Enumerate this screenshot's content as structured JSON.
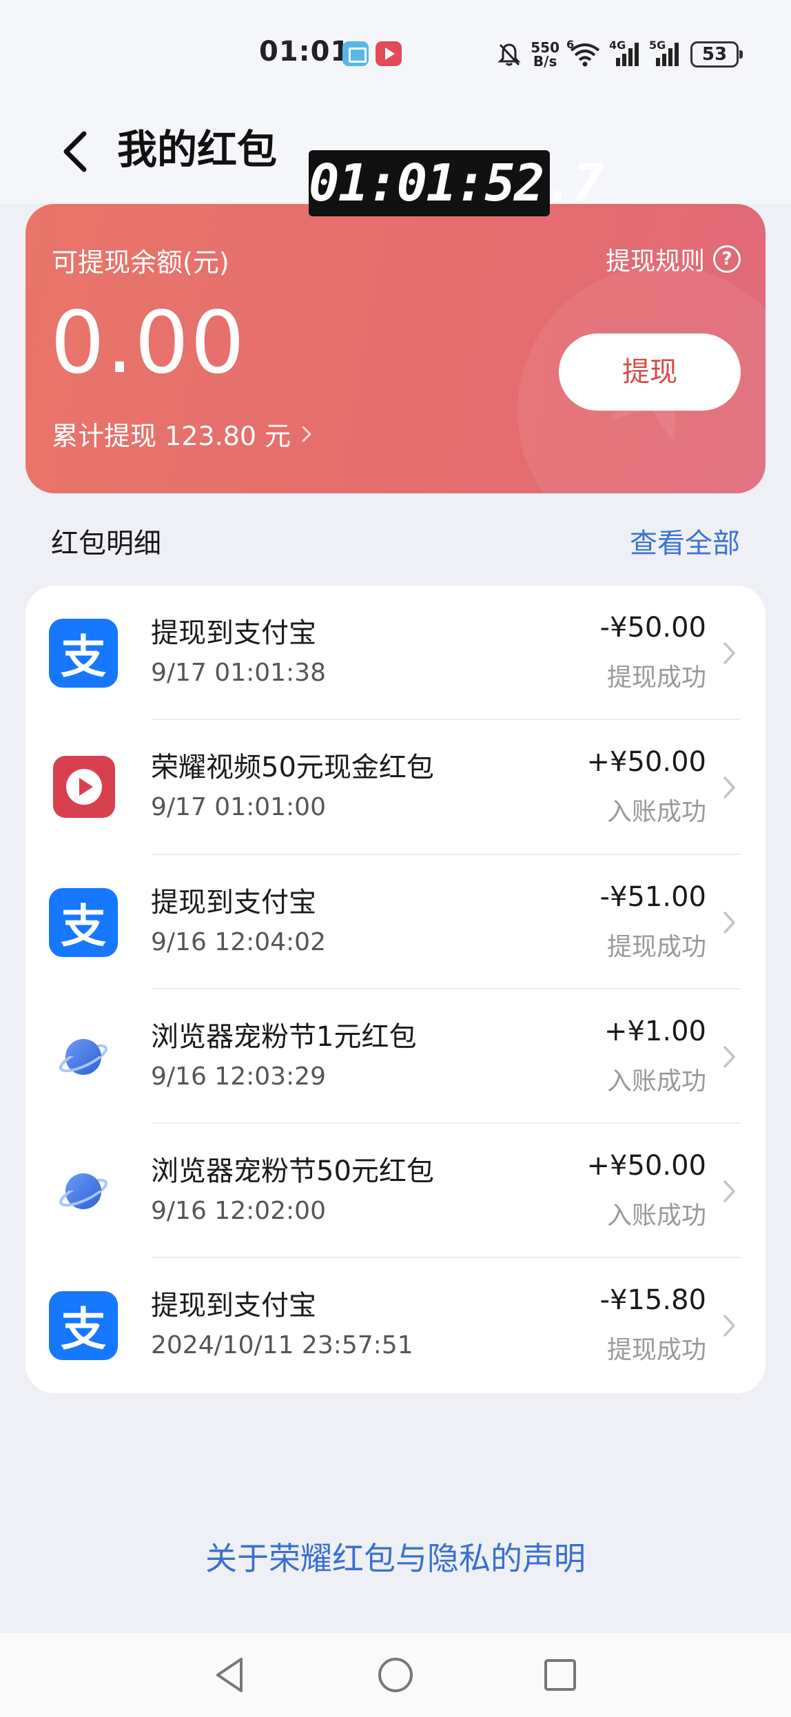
{
  "status_bar": {
    "time": "01:01",
    "net_speed_top": "550",
    "net_speed_bottom": "B/s",
    "wifi_label": "6",
    "sim1_label": "4G",
    "sim2_label": "5G",
    "battery": "53"
  },
  "header": {
    "title": "我的红包"
  },
  "overlay_timestamp": "01:01:52.7",
  "balance_card": {
    "label": "可提现余额(元)",
    "rules_label": "提现规则",
    "amount": "0.00",
    "withdraw_button": "提现",
    "total_withdraw": "累计提现 123.80 元"
  },
  "details": {
    "section_title": "红包明细",
    "view_all": "查看全部",
    "items": [
      {
        "icon": "alipay-icon",
        "title": "提现到支付宝",
        "time": "9/17 01:01:38",
        "amount": "-¥50.00",
        "status": "提现成功"
      },
      {
        "icon": "honor-video-icon",
        "title": "荣耀视频50元现金红包",
        "time": "9/17 01:01:00",
        "amount": "+¥50.00",
        "status": "入账成功"
      },
      {
        "icon": "alipay-icon",
        "title": "提现到支付宝",
        "time": "9/16 12:04:02",
        "amount": "-¥51.00",
        "status": "提现成功"
      },
      {
        "icon": "browser-planet-icon",
        "title": "浏览器宠粉节1元红包",
        "time": "9/16 12:03:29",
        "amount": "+¥1.00",
        "status": "入账成功"
      },
      {
        "icon": "browser-planet-icon",
        "title": "浏览器宠粉节50元红包",
        "time": "9/16 12:02:00",
        "amount": "+¥50.00",
        "status": "入账成功"
      },
      {
        "icon": "alipay-icon",
        "title": "提现到支付宝",
        "time": "2024/10/11 23:57:51",
        "amount": "-¥15.80",
        "status": "提现成功"
      }
    ]
  },
  "footer": {
    "privacy_link": "关于荣耀红包与隐私的声明"
  },
  "icons": {
    "alipay_glyph": "支",
    "help_glyph": "?"
  },
  "colors": {
    "card_gradient_start": "#e87569",
    "card_gradient_end": "#e06a78",
    "link_blue": "#3a73d1",
    "withdraw_text": "#d74b45",
    "alipay_blue": "#1677ff"
  }
}
